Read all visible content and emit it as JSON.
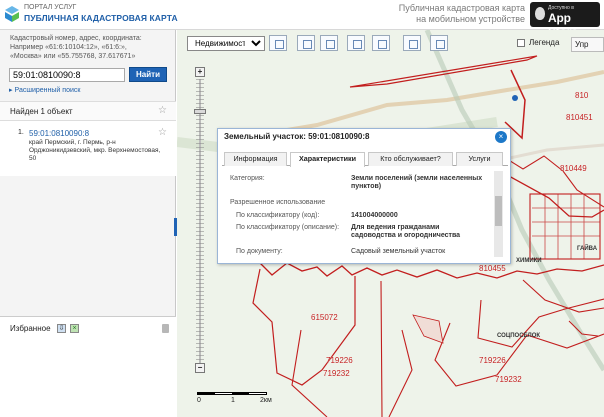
{
  "header": {
    "portal": "ПОРТАЛ УСЛУГ",
    "title": "ПУБЛИЧНАЯ КАДАСТРОВАЯ КАРТА",
    "mobile_line1": "Публичная кадастровая карта",
    "mobile_line2": "на мобильном устройстве",
    "store_small": "Доступно в",
    "store_big": "App Store"
  },
  "sidebar": {
    "hint": [
      "Кадастровый номер, адрес, координата:",
      "Например «61:6:10104:12», «61:6:»,",
      "«Москва» или «55.755768, 37.617671»"
    ],
    "search_value": "59:01:0810090:8",
    "find_label": "Найти",
    "advanced_label": "Расширенный поиск",
    "found_label": "Найден 1 объект",
    "result": {
      "index": "1.",
      "number": "59:01:0810090:8",
      "address": "край Пермский, г. Пермь, р-н Орджоникидзевский, мкр. Верхнемостовая, 50"
    },
    "favorites_label": "Избранное"
  },
  "toolbar": {
    "select_value": "Недвижимость",
    "legend_label": "Легенда",
    "layers_label": "Упр"
  },
  "map": {
    "labels": [
      "810451",
      "810449",
      "810455",
      "615072",
      "719226",
      "719232",
      "719226",
      "719232",
      "810"
    ],
    "towns": [
      "ХИМИКИ",
      "ГАЙВА",
      "СОЦПОСЕЛОК"
    ],
    "scale": {
      "zero": "0",
      "one": "1",
      "two": "2км"
    }
  },
  "popup": {
    "title": "Земельный участок: 59:01:0810090:8",
    "tabs": [
      "Информация",
      "Характеристики",
      "Кто обслуживает?",
      "Услуги"
    ],
    "category_label": "Категория:",
    "category_value": "Земли поселений (земли населенных пунктов)",
    "usage_label": "Разрешенное использование",
    "code_label": "По классификатору (код):",
    "code_value": "141004000000",
    "desc_label": "По классификатору (описание):",
    "desc_value": "Для ведения гражданами садоводства и огородничества",
    "doc_label": "По документу:",
    "doc_value": "Садовый земельный участок"
  },
  "colors": {
    "brand": "#1f5fa8",
    "button": "#1f63b5",
    "boundary": "#c21e1e",
    "map": "#eef3ea"
  }
}
